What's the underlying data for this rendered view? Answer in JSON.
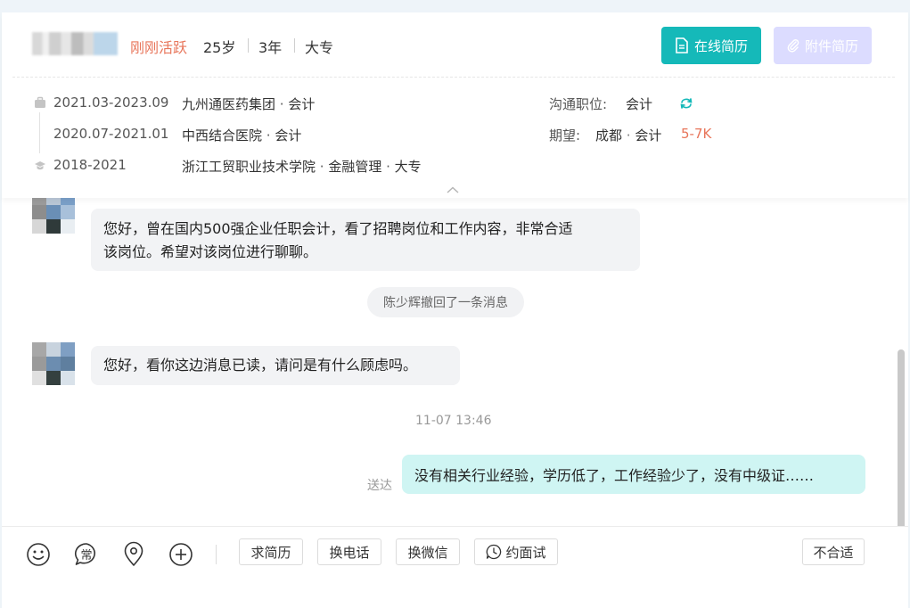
{
  "candidate": {
    "status": "刚刚活跃",
    "age": "25岁",
    "experience": "3年",
    "education": "大专"
  },
  "actions": {
    "online_resume": "在线简历",
    "attachment_resume": "附件简历"
  },
  "history": [
    {
      "period": "2021.03-2023.09",
      "org": "九州通医药集团",
      "role": "会计"
    },
    {
      "period": "2020.07-2021.01",
      "org": "中西结合医院",
      "role": "会计"
    },
    {
      "period": "2018-2021",
      "org": "浙江工贸职业技术学院",
      "major": "金融管理",
      "degree": "大专"
    }
  ],
  "position": {
    "label": "沟通职位:",
    "value": "会计"
  },
  "expectation": {
    "label": "期望:",
    "city": "成都",
    "role": "会计",
    "salary": "5-7K"
  },
  "chat": {
    "msg1": "您好，曾在国内500强企业任职会计，看了招聘岗位和工作内容，非常合适该岗位。希望对该岗位进行聊聊。",
    "msg1_line1": "您好，曾在国内500强企业任职会计，看了招聘岗位和工作内容，非常合适",
    "msg1_line2": "该岗位。希望对该岗位进行聊聊。",
    "recall": "陈少辉撤回了一条消息",
    "msg2": "您好，看你这边消息已读，请问是有什么顾虑吗。",
    "timestamp": "11-07 13:46",
    "delivered": "送达",
    "msg3": "没有相关行业经验，学历低了，工作经验少了，没有中级证……"
  },
  "toolbar": {
    "icons": [
      "emoji-icon",
      "common-phrase-icon",
      "location-icon",
      "plus-icon"
    ],
    "common_glyph": "常",
    "request_resume": "求简历",
    "exchange_phone": "换电话",
    "exchange_wechat": "换微信",
    "interview": "约面试",
    "not_suitable": "不合适"
  },
  "colors": {
    "accent": "#15b9b9",
    "active": "#e8765b",
    "attach_disabled": "#dcdcff",
    "bubble_self": "#cff5f3",
    "bubble_other": "#f2f3f5"
  }
}
